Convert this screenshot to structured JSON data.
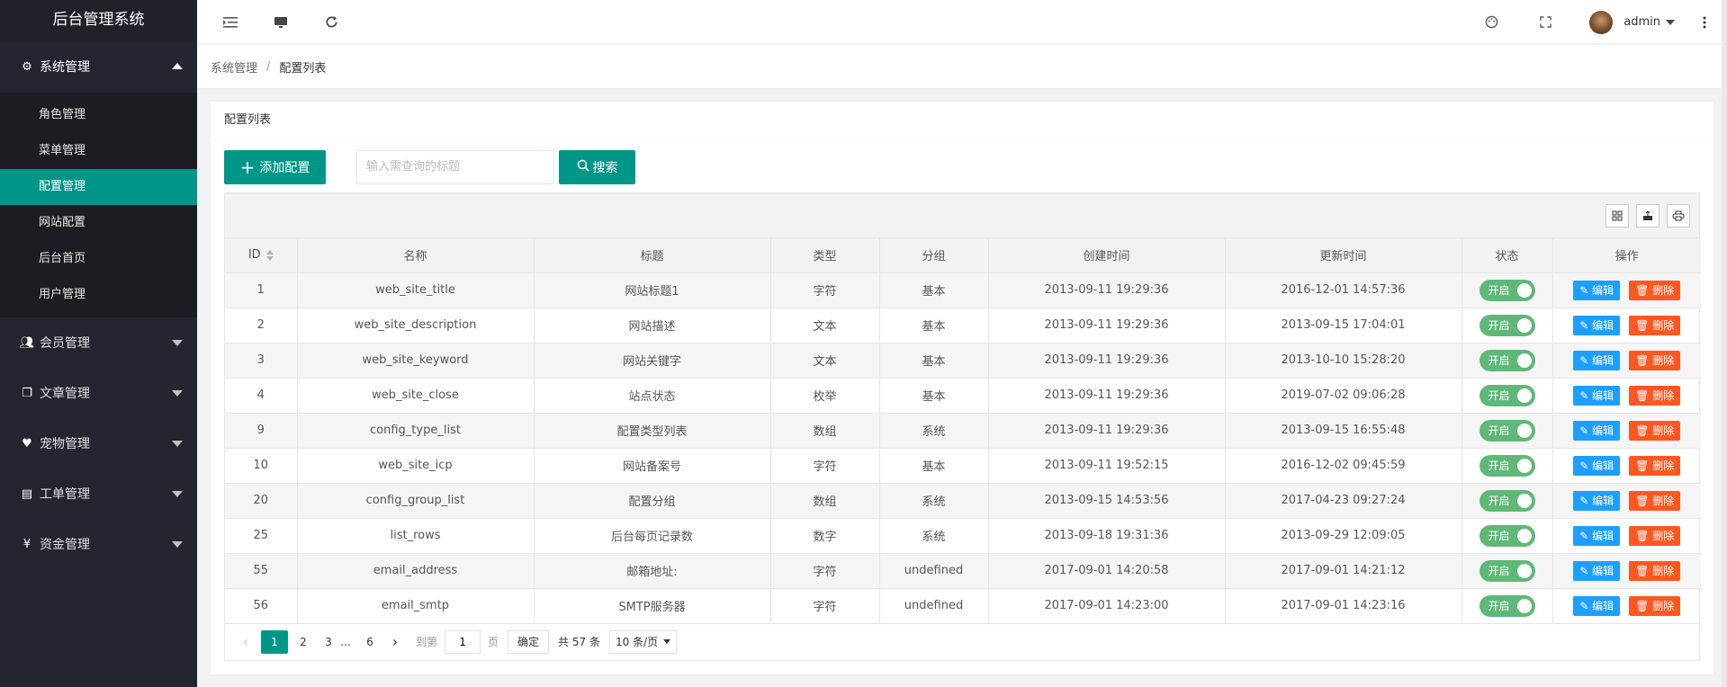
{
  "app": {
    "title": "后台管理系统"
  },
  "sidebar": {
    "groups": [
      {
        "label": "系统管理",
        "icon": "gear-icon",
        "expanded": true,
        "items": [
          "角色管理",
          "菜单管理",
          "配置管理",
          "网站配置",
          "后台首页",
          "用户管理"
        ],
        "active": "配置管理"
      },
      {
        "label": "会员管理",
        "icon": "users-icon",
        "expanded": false
      },
      {
        "label": "文章管理",
        "icon": "copy-icon",
        "expanded": false
      },
      {
        "label": "宠物管理",
        "icon": "heart-icon",
        "expanded": false
      },
      {
        "label": "工单管理",
        "icon": "file-icon",
        "expanded": false
      },
      {
        "label": "资金管理",
        "icon": "yen-icon",
        "expanded": false
      }
    ]
  },
  "topbar": {
    "icons": [
      "menu-shrink-icon",
      "monitor-icon",
      "refresh-icon"
    ],
    "right_icons": [
      "theme-icon",
      "fullscreen-icon"
    ],
    "user": "admin"
  },
  "breadcrumb": {
    "parent": "系统管理",
    "current": "配置列表"
  },
  "card": {
    "title": "配置列表",
    "add_label": "添加配置",
    "search_placeholder": "输入需查询的标题",
    "search_label": "搜索"
  },
  "table": {
    "columns": [
      "ID",
      "名称",
      "标题",
      "类型",
      "分组",
      "创建时间",
      "更新时间",
      "状态",
      "操作"
    ],
    "rows": [
      [
        "1",
        "web_site_title",
        "网站标题1",
        "字符",
        "基本",
        "2013-09-11 19:29:36",
        "2016-12-01 14:57:36"
      ],
      [
        "2",
        "web_site_description",
        "网站描述",
        "文本",
        "基本",
        "2013-09-11 19:29:36",
        "2013-09-15 17:04:01"
      ],
      [
        "3",
        "web_site_keyword",
        "网站关键字",
        "文本",
        "基本",
        "2013-09-11 19:29:36",
        "2013-10-10 15:28:20"
      ],
      [
        "4",
        "web_site_close",
        "站点状态",
        "枚举",
        "基本",
        "2013-09-11 19:29:36",
        "2019-07-02 09:06:28"
      ],
      [
        "9",
        "config_type_list",
        "配置类型列表",
        "数组",
        "系统",
        "2013-09-11 19:29:36",
        "2013-09-15 16:55:48"
      ],
      [
        "10",
        "web_site_icp",
        "网站备案号",
        "字符",
        "基本",
        "2013-09-11 19:52:15",
        "2016-12-02 09:45:59"
      ],
      [
        "20",
        "config_group_list",
        "配置分组",
        "数组",
        "系统",
        "2013-09-15 14:53:56",
        "2017-04-23 09:27:24"
      ],
      [
        "25",
        "list_rows",
        "后台每页记录数",
        "数字",
        "系统",
        "2013-09-18 19:31:36",
        "2013-09-29 12:09:05"
      ],
      [
        "55",
        "email_address",
        "邮箱地址:",
        "字符",
        "undefined",
        "2017-09-01 14:20:58",
        "2017-09-01 14:21:12"
      ],
      [
        "56",
        "email_smtp",
        "SMTP服务器",
        "字符",
        "undefined",
        "2017-09-01 14:23:00",
        "2017-09-01 14:23:16"
      ]
    ],
    "switch_label": "开启",
    "edit_label": "编辑",
    "delete_label": "删除"
  },
  "pager": {
    "pages": [
      "1",
      "2",
      "3",
      "…",
      "6"
    ],
    "current": "1",
    "goto_label": "到第",
    "goto_value": "1",
    "page_unit": "页",
    "confirm": "确定",
    "total": "共 57 条",
    "limit": "10 条/页"
  },
  "colors": {
    "primary": "#009688",
    "sidebar": "#23262e",
    "edit": "#1e9fff",
    "delete": "#ff5722",
    "switch_on": "#5fb878"
  }
}
